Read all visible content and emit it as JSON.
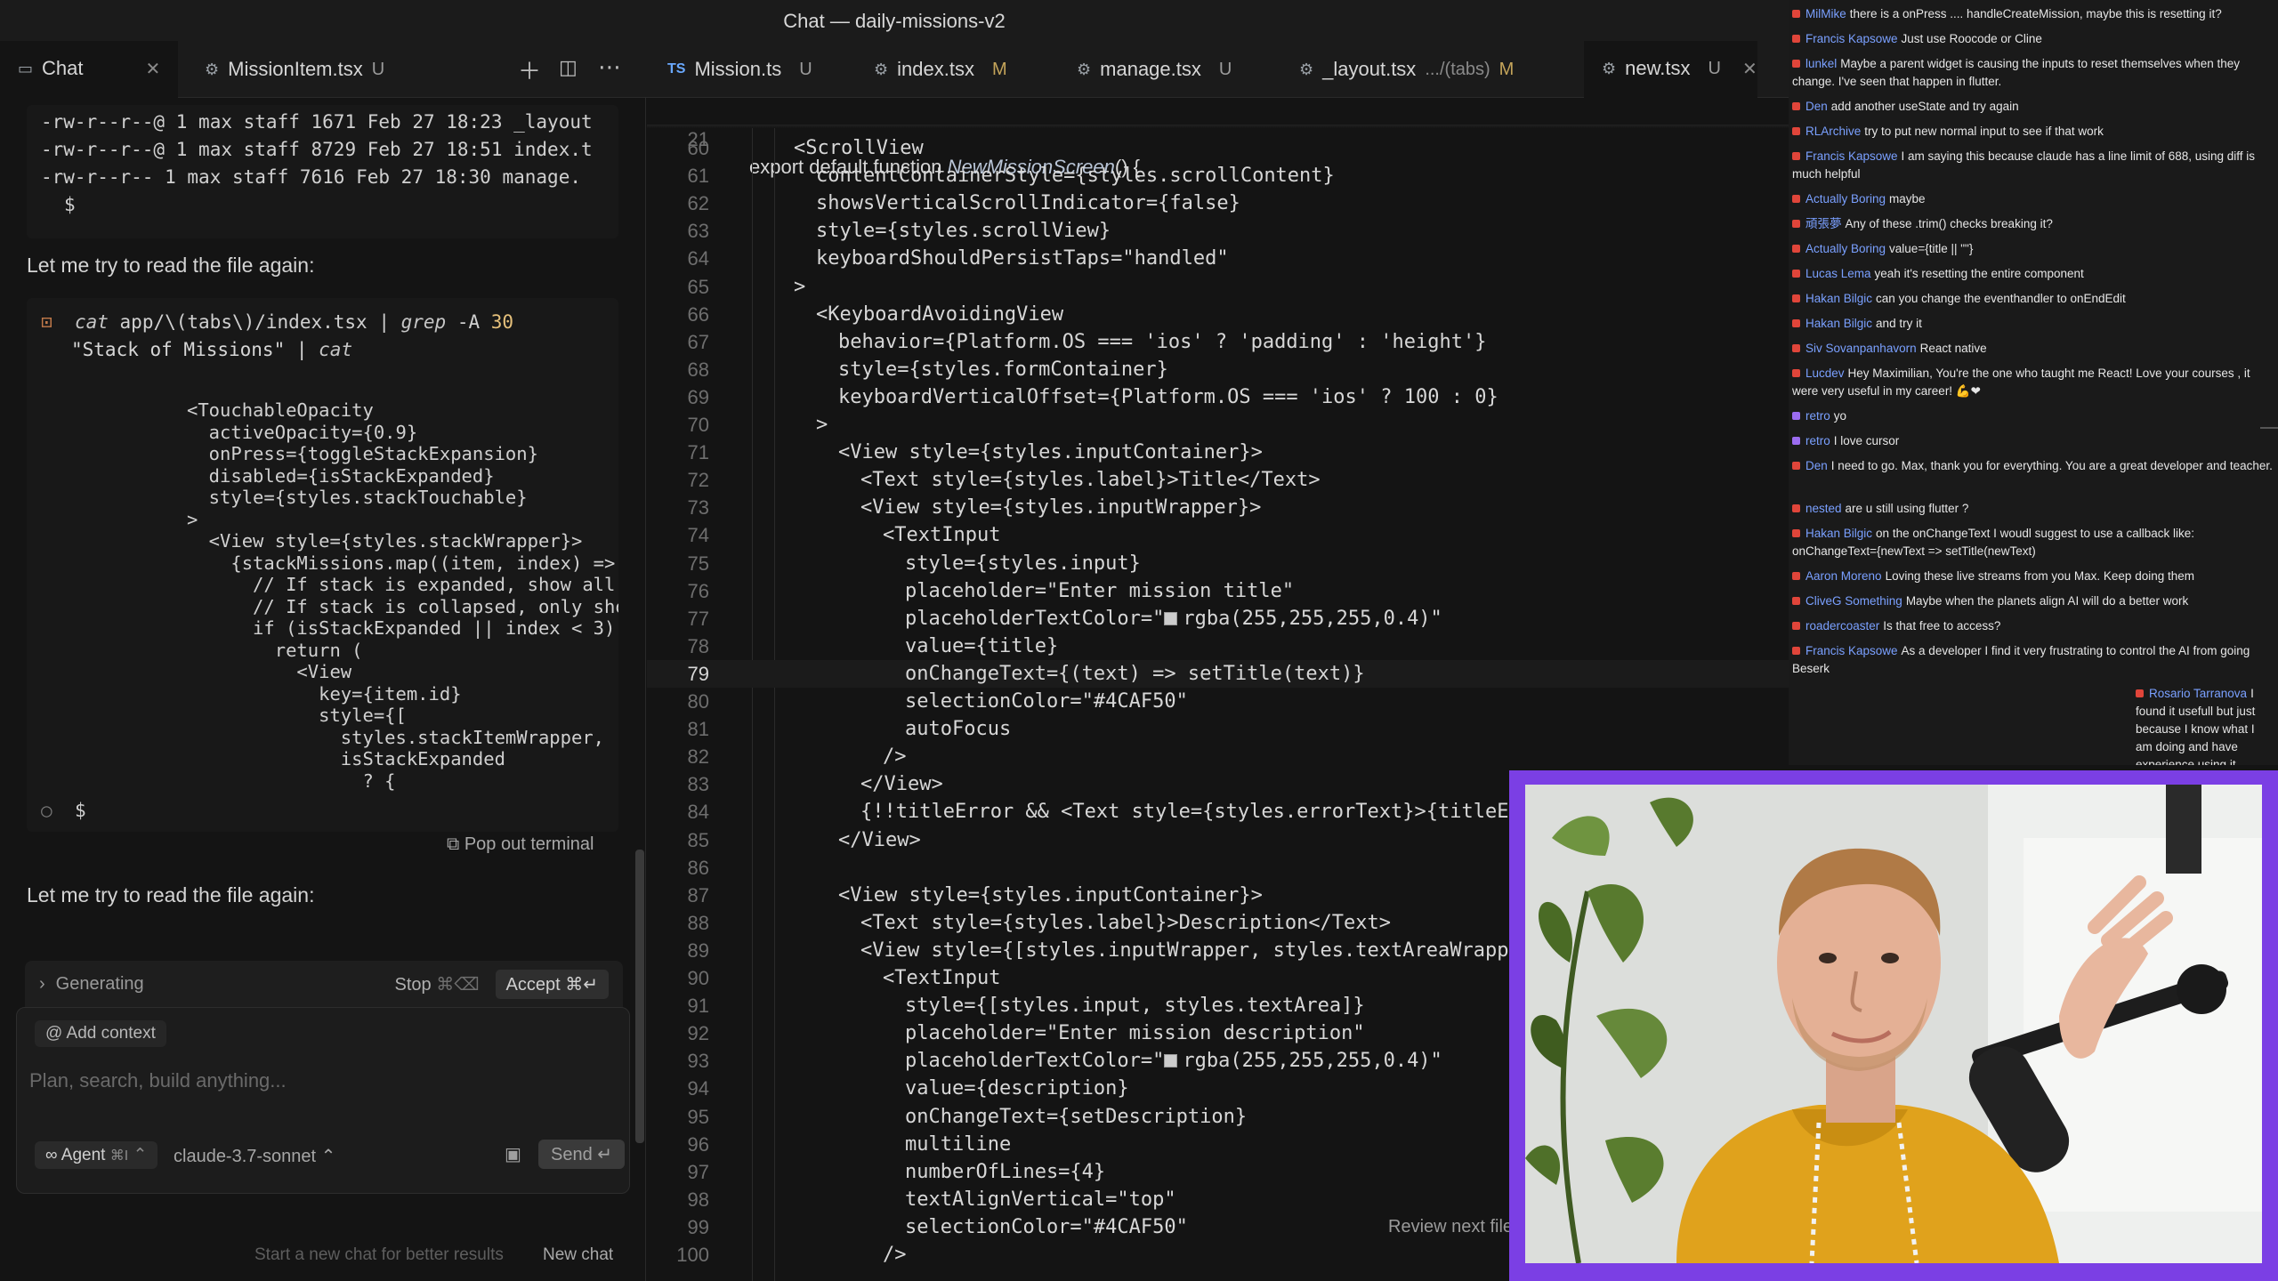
{
  "window": {
    "title": "Chat — daily-missions-v2"
  },
  "tabs": {
    "chat": {
      "label": "Chat"
    },
    "mission_item": {
      "label": "MissionItem.tsx",
      "status": "U"
    },
    "editor_tabs": [
      {
        "icon": "TS",
        "label": "Mission.ts",
        "status": "U",
        "suffix": ""
      },
      {
        "icon": "⚙",
        "label": "index.tsx",
        "status": "M",
        "suffix": ""
      },
      {
        "icon": "⚙",
        "label": "manage.tsx",
        "status": "U",
        "suffix": ""
      },
      {
        "icon": "⚙",
        "label": "_layout.tsx",
        "status": "M",
        "suffix": ".../(tabs)"
      },
      {
        "icon": "⚙",
        "label": "new.tsx",
        "status": "U",
        "suffix": ""
      }
    ]
  },
  "chat_panel": {
    "listing": [
      {
        "perm": "-rw-r--r--@",
        "links": "1",
        "user": "max",
        "group": "staff",
        "size": "1671",
        "date": "Feb 27 18:23",
        "name": "_layout"
      },
      {
        "perm": "-rw-r--r--@",
        "links": "1",
        "user": "max",
        "group": "staff",
        "size": "8729",
        "date": "Feb 27 18:51",
        "name": "index.t"
      },
      {
        "perm": "-rw-r--r--",
        "links": "1",
        "user": "max",
        "group": "staff",
        "size": "7616",
        "date": "Feb 27 18:30",
        "name": "manage."
      }
    ],
    "prompt_symbol": "$",
    "message_1": "Let me try to read the file again:",
    "command": {
      "line1_cmd": "cat",
      "line1_path": " app/\\(tabs\\)/index.tsx | ",
      "line1_grep": "grep",
      "line1_flag": " -A ",
      "line1_num": "30",
      "line2": "\"Stack of Missions\" | ",
      "line2_cat": "cat"
    },
    "output_lines": [
      "<TouchableOpacity",
      "  activeOpacity={0.9}",
      "  onPress={toggleStackExpansion}",
      "  disabled={isStackExpanded}",
      "  style={styles.stackTouchable}",
      ">",
      "  <View style={styles.stackWrapper}>",
      "    {stackMissions.map((item, index) => {",
      "      // If stack is expanded, show all m",
      "      // If stack is collapsed, only show",
      "      if (isStackExpanded || index < 3) {",
      "        return (",
      "          <View",
      "            key={item.id}",
      "            style={[",
      "              styles.stackItemWrapper,",
      "              isStackExpanded",
      "                ? {"
    ],
    "pop_out": "Pop out terminal",
    "message_2": "Let me try to read the file again:",
    "composer": {
      "status": "Generating",
      "stop": "Stop",
      "stop_shortcut": "⌘⌫",
      "accept": "Accept",
      "accept_shortcut": "⌘↵",
      "add_context": "Add context",
      "placeholder": "Plan, search, build anything...",
      "agent": "Agent",
      "agent_shortcut": "⌘I",
      "model": "claude-3.7-sonnet",
      "send": "Send",
      "send_shortcut": "↵"
    },
    "new_chat_hint": "Start a new chat for better results",
    "new_chat": "New chat"
  },
  "editor": {
    "sticky": {
      "ln": "21",
      "text_pre": "export default function ",
      "text_fn": "NewMissionScreen",
      "text_post": "() {"
    },
    "lines": [
      {
        "ln": "60",
        "indent": 2,
        "text": "<ScrollView"
      },
      {
        "ln": "61",
        "indent": 3,
        "text": "contentContainerStyle={styles.scrollContent}"
      },
      {
        "ln": "62",
        "indent": 3,
        "text": "showsVerticalScrollIndicator={false}"
      },
      {
        "ln": "63",
        "indent": 3,
        "text": "style={styles.scrollView}"
      },
      {
        "ln": "64",
        "indent": 3,
        "text": "keyboardShouldPersistTaps=\"handled\""
      },
      {
        "ln": "65",
        "indent": 2,
        "text": ">"
      },
      {
        "ln": "66",
        "indent": 3,
        "text": "<KeyboardAvoidingView"
      },
      {
        "ln": "67",
        "indent": 4,
        "text": "behavior={Platform.OS === 'ios' ? 'padding' : 'height'}"
      },
      {
        "ln": "68",
        "indent": 4,
        "text": "style={styles.formContainer}"
      },
      {
        "ln": "69",
        "indent": 4,
        "text": "keyboardVerticalOffset={Platform.OS === 'ios' ? 100 : 0}"
      },
      {
        "ln": "70",
        "indent": 3,
        "text": ">"
      },
      {
        "ln": "71",
        "indent": 4,
        "text": "<View style={styles.inputContainer}>"
      },
      {
        "ln": "72",
        "indent": 5,
        "text": "<Text style={styles.label}>Title</Text>"
      },
      {
        "ln": "73",
        "indent": 5,
        "text": "<View style={styles.inputWrapper}>"
      },
      {
        "ln": "74",
        "indent": 6,
        "text": "<TextInput"
      },
      {
        "ln": "75",
        "indent": 7,
        "text": "style={styles.input}"
      },
      {
        "ln": "76",
        "indent": 7,
        "text": "placeholder=\"Enter mission title\""
      },
      {
        "ln": "77",
        "indent": 7,
        "text": "placeholderTextColor=\"rgba(255,255,255,0.4)\"",
        "swatch": true
      },
      {
        "ln": "78",
        "indent": 7,
        "text": "value={title}"
      },
      {
        "ln": "79",
        "indent": 7,
        "text": "onChangeText={(text) => setTitle(text)}",
        "current": true
      },
      {
        "ln": "80",
        "indent": 7,
        "text": "selectionColor=\"#4CAF50\""
      },
      {
        "ln": "81",
        "indent": 7,
        "text": "autoFocus"
      },
      {
        "ln": "82",
        "indent": 6,
        "text": "/>"
      },
      {
        "ln": "83",
        "indent": 5,
        "text": "</View>"
      },
      {
        "ln": "84",
        "indent": 5,
        "text": "{!!titleError && <Text style={styles.errorText}>{titleErr"
      },
      {
        "ln": "85",
        "indent": 4,
        "text": "</View>"
      },
      {
        "ln": "86",
        "indent": 0,
        "text": ""
      },
      {
        "ln": "87",
        "indent": 4,
        "text": "<View style={styles.inputContainer}>"
      },
      {
        "ln": "88",
        "indent": 5,
        "text": "<Text style={styles.label}>Description</Text>"
      },
      {
        "ln": "89",
        "indent": 5,
        "text": "<View style={[styles.inputWrapper, styles.textAreaWrapper"
      },
      {
        "ln": "90",
        "indent": 6,
        "text": "<TextInput"
      },
      {
        "ln": "91",
        "indent": 7,
        "text": "style={[styles.input, styles.textArea]}"
      },
      {
        "ln": "92",
        "indent": 7,
        "text": "placeholder=\"Enter mission description\""
      },
      {
        "ln": "93",
        "indent": 7,
        "text": "placeholderTextColor=\"rgba(255,255,255,0.4)\"",
        "swatch": true
      },
      {
        "ln": "94",
        "indent": 7,
        "text": "value={description}"
      },
      {
        "ln": "95",
        "indent": 7,
        "text": "onChangeText={setDescription}"
      },
      {
        "ln": "96",
        "indent": 7,
        "text": "multiline"
      },
      {
        "ln": "97",
        "indent": 7,
        "text": "numberOfLines={4}"
      },
      {
        "ln": "98",
        "indent": 7,
        "text": "textAlignVertical=\"top\""
      },
      {
        "ln": "99",
        "indent": 7,
        "text": "selectionColor=\"#4CAF50\""
      },
      {
        "ln": "100",
        "indent": 6,
        "text": "/>"
      }
    ],
    "review_hint": "Review next file"
  },
  "livechat": [
    {
      "user": "MilMike",
      "text": "there is a onPress .... handleCreateMission, maybe this is resetting it?"
    },
    {
      "user": "Francis Kapsowe",
      "text": "Just use Roocode or Cline"
    },
    {
      "user": "lunkel",
      "text": "Maybe a parent widget is causing the inputs to reset themselves when they change. I've seen that happen in flutter."
    },
    {
      "user": "Den",
      "text": "add another useState and try again"
    },
    {
      "user": "RLArchive",
      "text": "try to put new normal input to see if that work"
    },
    {
      "user": "Francis Kapsowe",
      "text": "I am saying this because claude has a line limit of 688, using diff is much helpful"
    },
    {
      "user": "Actually Boring",
      "text": "maybe"
    },
    {
      "user": "頑張夢",
      "text": "Any of these .trim() checks breaking it?"
    },
    {
      "user": "Actually Boring",
      "text": "value={title || \"\"}"
    },
    {
      "user": "Lucas Lema",
      "text": "yeah it's resetting the entire component"
    },
    {
      "user": "Hakan Bilgic",
      "text": "can you change the eventhandler to onEndEdit"
    },
    {
      "user": "Hakan Bilgic",
      "text": "and try it"
    },
    {
      "user": "Siv Sovanpanhavorn",
      "text": "React native"
    },
    {
      "user": "Lucdev",
      "text": "Hey Maximilian, You're the one who taught me React! Love your courses , it were very useful in my career! 💪❤"
    },
    {
      "user": "retro",
      "text": "yo",
      "twitch": true
    },
    {
      "user": "retro",
      "text": "I love cursor",
      "twitch": true
    },
    {
      "user": "Den",
      "text": "I need to go. Max, thank you for everything. You are a great developer and teacher."
    },
    {
      "user": "nested",
      "text": "are u still using flutter ?"
    },
    {
      "user": "Hakan Bilgic",
      "text": "on the onChangeText I woudl suggest to use a callback like: onChangeText={newText => setTitle(newText)"
    },
    {
      "user": "Aaron Moreno",
      "text": "Loving these live streams from you Max. Keep doing them"
    },
    {
      "user": "CliveG Something",
      "text": "Maybe when the planets align AI will do a better work"
    },
    {
      "user": "roadercoaster",
      "text": "Is that free to access?"
    },
    {
      "user": "Francis Kapsowe",
      "text": "As a developer I find it very frustrating to control the AI from going Beserk"
    },
    {
      "user": "Rosario Tarranova",
      "text": "I found it usefull but just because I know what I am doing and have experience using it"
    }
  ],
  "colors": {
    "accent_frame": "#7b3fe4",
    "hoodie": "#e0a21c"
  }
}
